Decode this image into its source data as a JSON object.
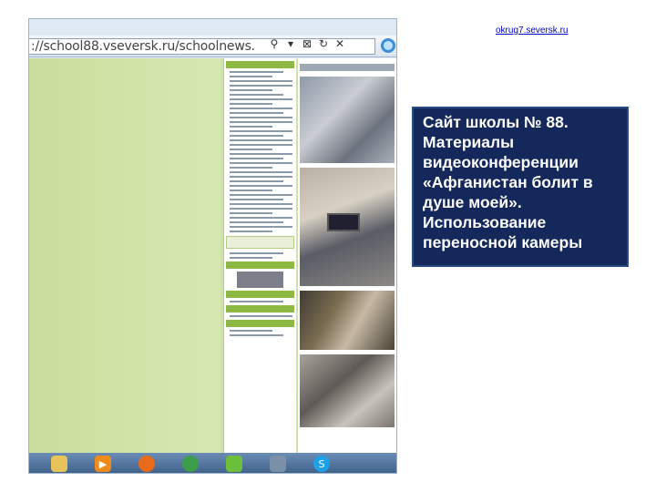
{
  "header": {
    "site_link": "okrug7.seversk.ru"
  },
  "browser": {
    "address": "://school88.vseversk.ru/schoolnews.",
    "icons": [
      "search-icon",
      "dropdown-icon",
      "stop-icon",
      "refresh-icon",
      "close-icon"
    ],
    "icon_glyphs": [
      "⚲",
      "▾",
      "⊠",
      "↻",
      "✕"
    ]
  },
  "taskbar": {
    "icons": [
      "folder-icon",
      "media-player-icon",
      "firefox-icon",
      "chrome-icon",
      "green-app-icon",
      "app-icon",
      "skype-icon"
    ],
    "glyphs": [
      "",
      "▶",
      "",
      "",
      "",
      "",
      "S"
    ]
  },
  "caption": {
    "lines": [
      "Сайт школы № 88.",
      "Материалы",
      "видеоконференции",
      "«Афганистан болит в",
      "душе моей».",
      "Использование",
      "переносной камеры"
    ]
  },
  "colors": {
    "caption_bg": "#14285c",
    "page_green": "#cfe2a9",
    "sidebar_head": "#8db842"
  }
}
